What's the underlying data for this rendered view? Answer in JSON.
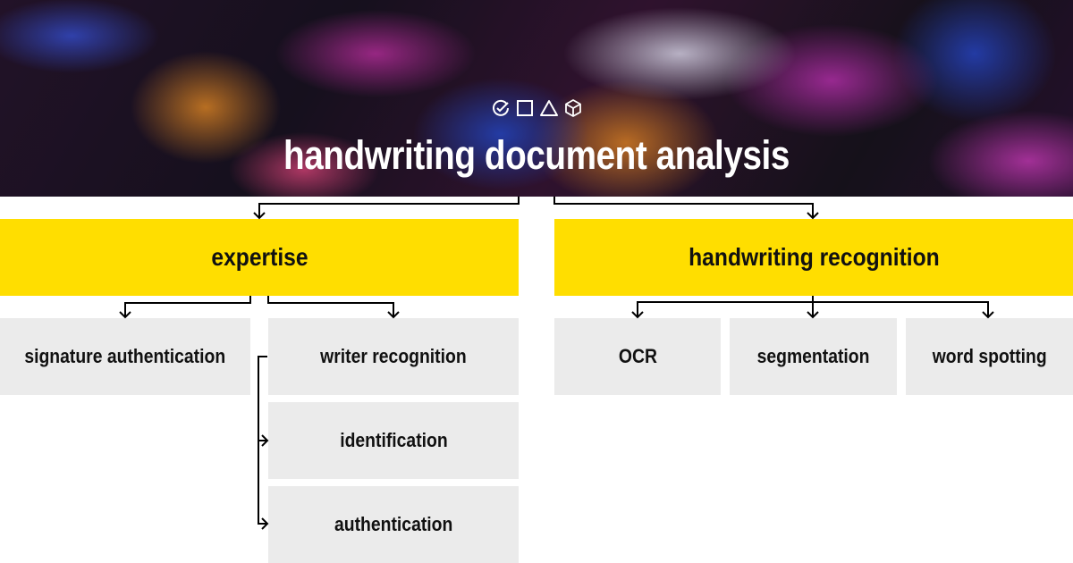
{
  "header": {
    "title": "handwriting document analysis",
    "icons": [
      "check-circle-icon",
      "square-icon",
      "triangle-icon",
      "cube-icon"
    ]
  },
  "colors": {
    "category_bg": "#ffde00",
    "leaf_bg": "#ebebeb",
    "connector": "#000000",
    "title_text": "#ffffff"
  },
  "diagram": {
    "branches": [
      {
        "label": "expertise",
        "children": [
          {
            "label": "signature authentication"
          },
          {
            "label": "writer recognition",
            "children": [
              {
                "label": "identification"
              },
              {
                "label": "authentication"
              }
            ]
          }
        ]
      },
      {
        "label": "handwriting recognition",
        "children": [
          {
            "label": "OCR"
          },
          {
            "label": "segmentation"
          },
          {
            "label": "word spotting"
          }
        ]
      }
    ]
  }
}
